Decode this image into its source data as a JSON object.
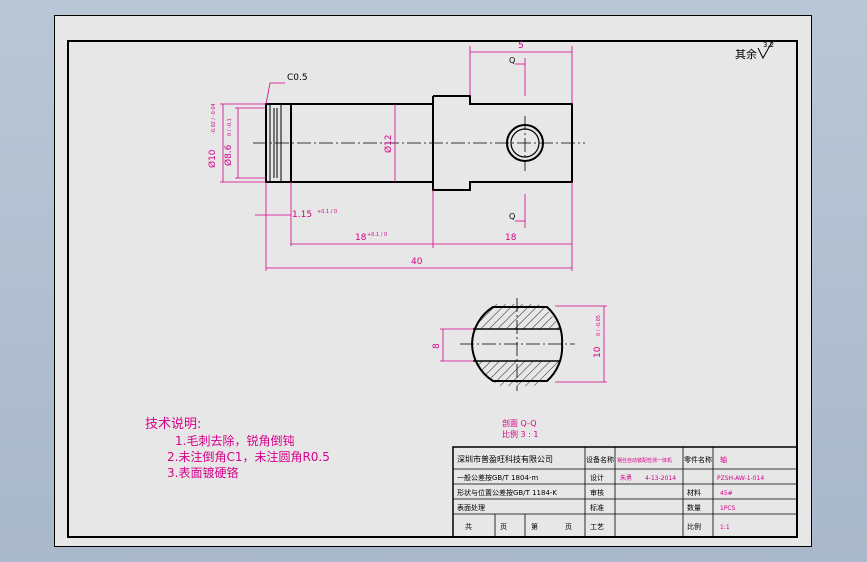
{
  "colors": {
    "background": "#b3c1d2",
    "sheet": "#e7e7e7",
    "line": "#000000",
    "dimension": "#d6008a"
  },
  "roughness": {
    "label": "其余",
    "value": "3.2"
  },
  "chamfer_callout": "C0.5",
  "dimensions": {
    "d_left_1": "Ø10",
    "d_left_1_tol": "-0.02 / -0.04",
    "d_left_2": "Ø8.6",
    "d_left_2_tol": "0 / -0.1",
    "d_mid": "Ø12",
    "top_len": "5",
    "groove_w": "1.15",
    "groove_tol": "+0.1 / 0",
    "len_18_left": "18",
    "len_18_tol": "+0.1 / 0",
    "len_18_right": "18",
    "total": "40",
    "sec_left": "8",
    "sec_right": "10",
    "sec_right_tol": "0 / -0.05"
  },
  "section_marks": {
    "top": "Q",
    "bottom": "Q"
  },
  "section_caption": {
    "line1": "剖面 Q-Q",
    "line2": "比例 3 : 1"
  },
  "notes": {
    "title": "技术说明:",
    "items": [
      "1.毛刺去除，锐角倒钝",
      "2.未注倒角C1，未注圆角R0.5",
      "3.表面镀硬铬"
    ]
  },
  "title_block": {
    "company": "深圳市普盈旺科技有限公司",
    "tol_1": "一般公差按GB/T 1804-m",
    "tol_2": "形状与位置公差按GB/T 1184-K",
    "tol_3": "表面处理",
    "total_label": "共",
    "page_label": "第",
    "pages_unit": "页",
    "equipment_label": "设备名称",
    "equipment_value": "钢丝自动装配检测一体机",
    "part_label": "零件名称",
    "part_value": "轴",
    "design_label": "设计",
    "design_name": "朱勇",
    "design_date": "4-13-2014",
    "check_label": "审核",
    "process_label": "工艺",
    "standard_label": "标准",
    "drawing_no_value": "PZSH-AW-1-014",
    "material_label": "材料",
    "material_value": "45#",
    "qty_label": "数量",
    "qty_value": "1PCS",
    "scale_label": "比例",
    "scale_value": "1:1"
  }
}
